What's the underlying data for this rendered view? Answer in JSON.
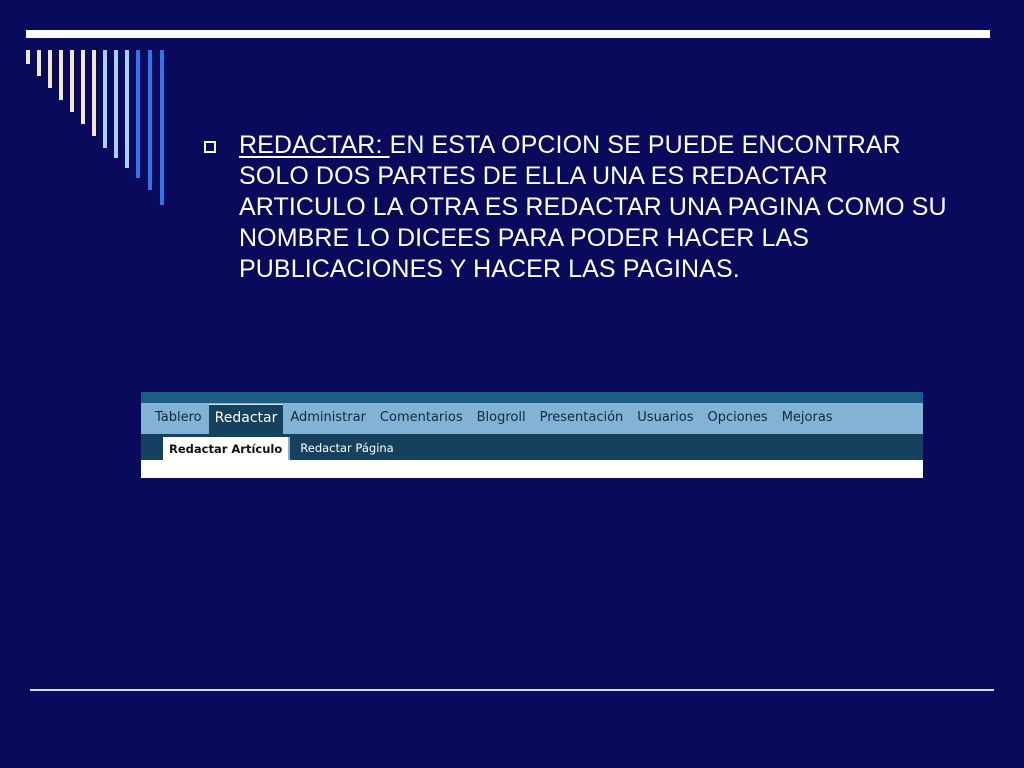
{
  "slide": {
    "colors": {
      "background": "#0a0a5c",
      "rule": "#ffffff",
      "stripe_light": "#f1e8c8",
      "stripe_mid": "#a8d0f2",
      "stripe_blue": "#2c76e8"
    },
    "decoration": {
      "stripe_count": 13
    },
    "bullet": {
      "icon": "hollow-square-icon",
      "term": "REDACTAR: ",
      "text": "EN ESTA OPCION SE PUEDE ENCONTRAR SOLO DOS PARTES DE ELLA UNA ES REDACTAR ARTICULO LA OTRA ES REDACTAR UNA PAGINA COMO SU NOMBRE LO DICEES PARA PODER HACER LAS PUBLICACIONES Y HACER LAS PAGINAS."
    }
  },
  "wordpress": {
    "menu": {
      "items": [
        {
          "label": "Tablero"
        },
        {
          "label": "Redactar",
          "active": true
        },
        {
          "label": "Administrar"
        },
        {
          "label": "Comentarios"
        },
        {
          "label": "Blogroll"
        },
        {
          "label": "Presentación"
        },
        {
          "label": "Usuarios"
        },
        {
          "label": "Opciones"
        },
        {
          "label": "Mejoras"
        }
      ]
    },
    "submenu": {
      "items": [
        {
          "label": "Redactar Artículo",
          "active": true
        },
        {
          "label": "Redactar Página"
        }
      ]
    }
  }
}
